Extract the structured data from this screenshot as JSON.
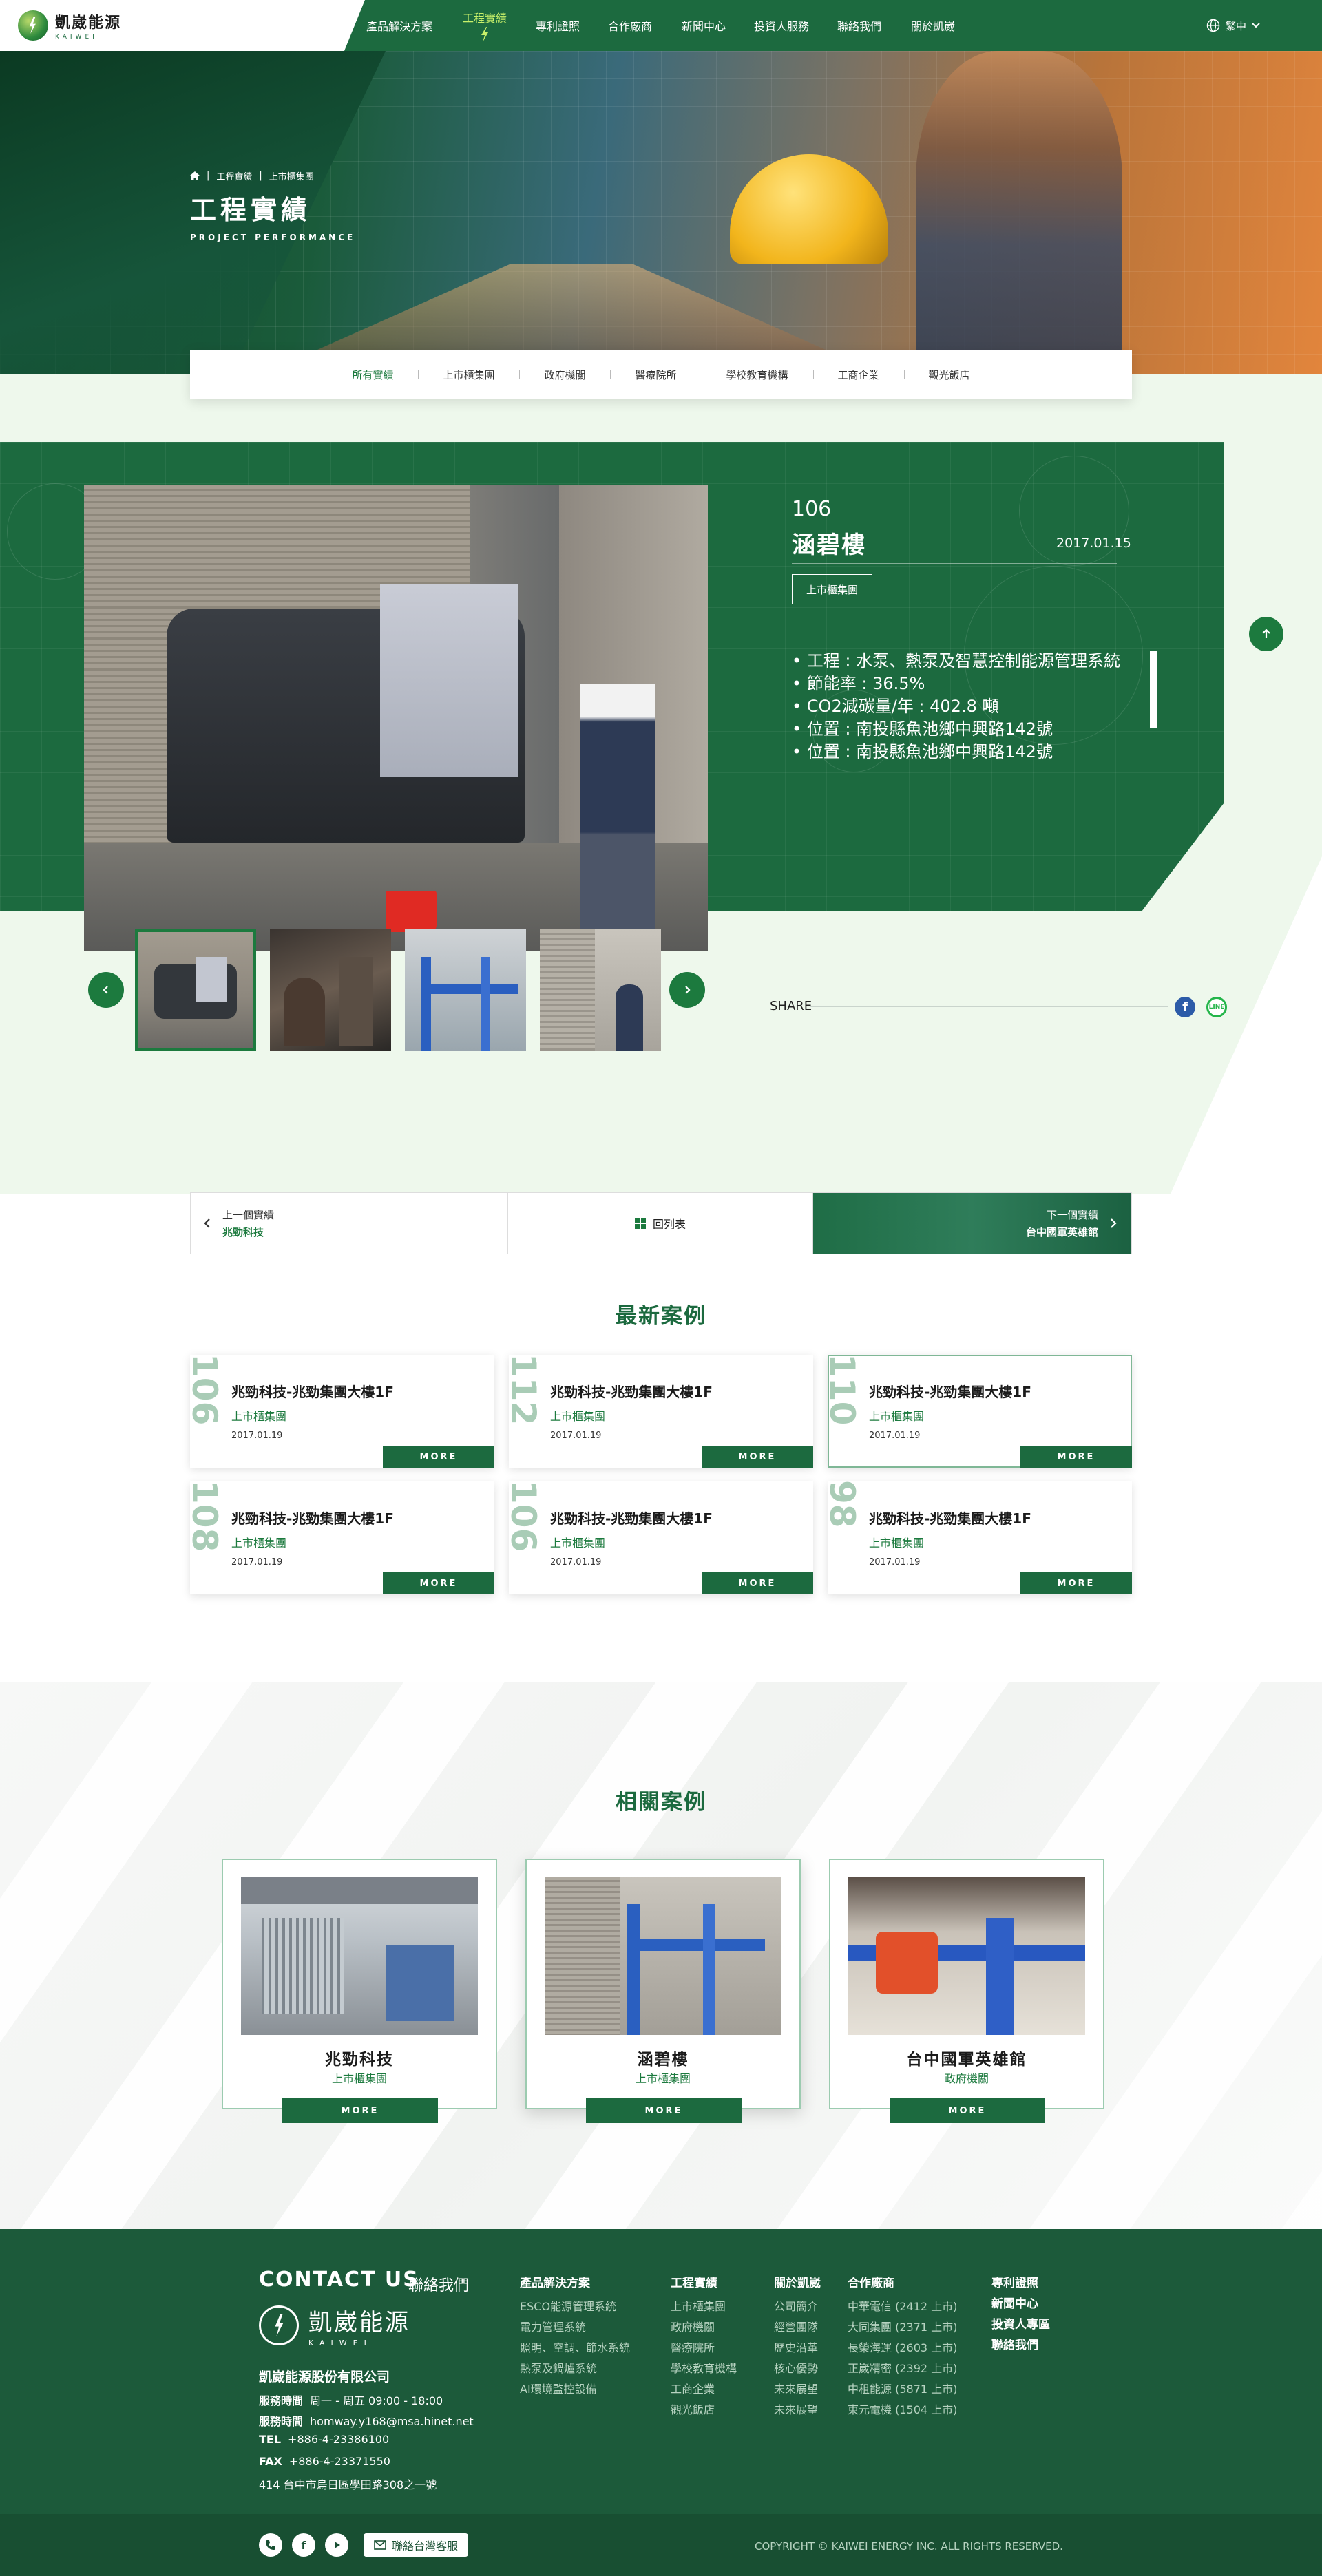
{
  "header": {
    "logo_name": "凱崴能源",
    "logo_sub": "KAIWEI",
    "nav": [
      "產品解決方案",
      "工程實績",
      "專利證照",
      "合作廠商",
      "新聞中心",
      "投資人服務",
      "聯絡我們",
      "關於凱崴"
    ],
    "active_nav": "工程實績",
    "lang": "繁中"
  },
  "hero": {
    "crumb": [
      "工程實績",
      "上市櫃集團"
    ],
    "title": "工程實績",
    "subtitle": "PROJECT PERFORMANCE"
  },
  "categories": [
    "所有實績",
    "上市櫃集團",
    "政府機關",
    "醫療院所",
    "學校教育機構",
    "工商企業",
    "觀光飯店"
  ],
  "active_category": "所有實績",
  "case": {
    "number": "106",
    "name": "涵碧樓",
    "date": "2017.01.15",
    "tag": "上市櫃集團",
    "details": [
      "工程 : 水泵、熱泵及智慧控制能源管理系統",
      "節能率 : 36.5%",
      "CO2減碳量/年 : 402.8 噸",
      "位置 : 南投縣魚池鄉中興路142號",
      "位置 : 南投縣魚池鄉中興路142號"
    ],
    "share_label": "SHARE"
  },
  "pager": {
    "prev_label": "上一個實績",
    "prev_name": "兆勁科技",
    "list_label": "回列表",
    "next_label": "下一個實績",
    "next_name": "台中國軍英雄館"
  },
  "latest": {
    "title": "最新案例",
    "more": "MORE",
    "cards": [
      {
        "num": "106",
        "title": "兆勁科技-兆勁集團大樓1F",
        "category": "上市櫃集團",
        "date": "2017.01.19"
      },
      {
        "num": "112",
        "title": "兆勁科技-兆勁集團大樓1F",
        "category": "上市櫃集團",
        "date": "2017.01.19"
      },
      {
        "num": "110",
        "title": "兆勁科技-兆勁集團大樓1F",
        "category": "上市櫃集團",
        "date": "2017.01.19"
      },
      {
        "num": "108",
        "title": "兆勁科技-兆勁集團大樓1F",
        "category": "上市櫃集團",
        "date": "2017.01.19"
      },
      {
        "num": "106",
        "title": "兆勁科技-兆勁集團大樓1F",
        "category": "上市櫃集團",
        "date": "2017.01.19"
      },
      {
        "num": "98",
        "title": "兆勁科技-兆勁集團大樓1F",
        "category": "上市櫃集團",
        "date": "2017.01.19"
      }
    ]
  },
  "related": {
    "title": "相關案例",
    "more": "MORE",
    "cards": [
      {
        "name": "兆勁科技",
        "category": "上市櫃集團"
      },
      {
        "name": "涵碧樓",
        "category": "上市櫃集團"
      },
      {
        "name": "台中國軍英雄館",
        "category": "政府機關"
      }
    ]
  },
  "footer": {
    "contact_title": "CONTACT US",
    "contact_title_zh": "聯絡我們",
    "logo_name": "凱崴能源",
    "logo_sub": "KAIWEI",
    "company": "凱崴能源股份有限公司",
    "hours_label": "服務時間",
    "hours": "周一 - 周五 09:00 - 18:00",
    "email_label": "服務時間",
    "email": "homway.y168@msa.hinet.net",
    "tel_label": "TEL",
    "tel": "+886-4-23386100",
    "fax_label": "FAX",
    "fax": "+886-4-23371550",
    "address": "414 台中市烏日區學田路308之一號",
    "col_products": {
      "head": "產品解決方案",
      "items": [
        "ESCO能源管理系統",
        "電力管理系統",
        "照明、空調、節水系統",
        "熱泵及鍋爐系統",
        "AI環境監控設備"
      ]
    },
    "col_projects": {
      "head": "工程實績",
      "items": [
        "上市櫃集團",
        "政府機關",
        "醫療院所",
        "學校教育機構",
        "工商企業",
        "觀光飯店"
      ]
    },
    "col_about": {
      "head": "關於凱崴",
      "items": [
        "公司簡介",
        "經營團隊",
        "歷史沿革",
        "核心優勢",
        "未來展望",
        "未來展望"
      ]
    },
    "col_partners": {
      "head": "合作廠商",
      "items": [
        "中華電信 (2412 上市)",
        "大同集團 (2371 上市)",
        "長榮海運 (2603 上市)",
        "正崴精密 (2392 上市)",
        "中租能源 (5871 上市)",
        "東元電機 (1504 上市)"
      ]
    },
    "col_links": [
      "專利證照",
      "新聞中心",
      "投資人專區",
      "聯絡我們"
    ],
    "service_button": "聯絡台灣客服",
    "copyright": "COPYRIGHT © KAIWEI ENERGY INC. ALL RIGHTS RESERVED."
  },
  "colors": {
    "brand_green": "#1c6a3f",
    "accent_green": "#1c7a3e",
    "nav_active": "#c8f06a",
    "pale_bg": "#eef8ec"
  }
}
